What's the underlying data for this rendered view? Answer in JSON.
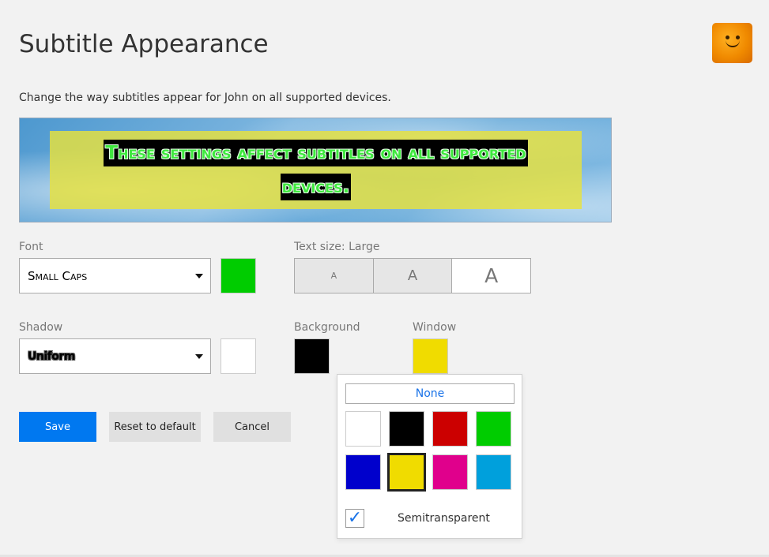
{
  "header": {
    "title": "Subtitle Appearance"
  },
  "description": "Change the way subtitles appear for John on all supported devices.",
  "preview": {
    "text": "These settings affect subtitles on all supported devices."
  },
  "font": {
    "label": "Font",
    "value": "Small Caps",
    "color": "#00cc00"
  },
  "text_size": {
    "label": "Text size: Large",
    "options": [
      "A",
      "A",
      "A"
    ],
    "selected": "Large"
  },
  "shadow": {
    "label": "Shadow",
    "value": "Uniform",
    "color": "#ffffff"
  },
  "background": {
    "label": "Background",
    "color": "#000000"
  },
  "window": {
    "label": "Window",
    "color": "#f0dc00"
  },
  "color_picker": {
    "none_label": "None",
    "colors": [
      "#ffffff",
      "#000000",
      "#cc0000",
      "#00cc00",
      "#0000cc",
      "#f0dc00",
      "#e0008c",
      "#00a0dc"
    ],
    "selected_color": "#f0dc00",
    "semitransparent_label": "Semitransparent",
    "semitransparent_checked": true,
    "check_glyph": "✓"
  },
  "buttons": {
    "save": "Save",
    "reset": "Reset to default",
    "cancel": "Cancel"
  },
  "icons": {
    "caret": "chevron-down-icon",
    "checkmark": "checkmark-icon"
  }
}
